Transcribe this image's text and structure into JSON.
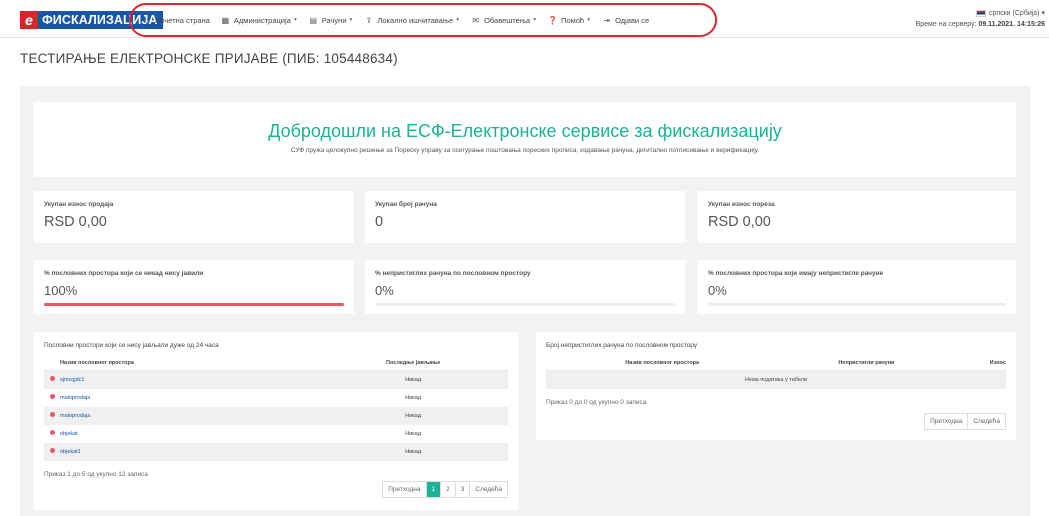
{
  "brand": {
    "letter": "е",
    "name": "ФИСКАЛИЗАЦИЈА",
    "icon": "fiscal-logo-icon"
  },
  "nav": [
    {
      "label": "Почетна страна",
      "icon": "home-icon",
      "glyph": "⌂",
      "caret": false
    },
    {
      "label": "Администрација",
      "icon": "grid-icon",
      "glyph": "▦",
      "caret": true
    },
    {
      "label": "Рачуни",
      "icon": "list-icon",
      "glyph": "▤",
      "caret": true
    },
    {
      "label": "Локално ишчитавање",
      "icon": "upload-icon",
      "glyph": "⇪",
      "caret": true
    },
    {
      "label": "Обавештења",
      "icon": "envelope-icon",
      "glyph": "✉",
      "caret": true
    },
    {
      "label": "Помоћ",
      "icon": "question-icon",
      "glyph": "❓",
      "caret": true
    },
    {
      "label": "Одјави се",
      "icon": "logout-icon",
      "glyph": "⇥",
      "caret": false
    }
  ],
  "language": "српски (Србија)",
  "server_time_label": "Време на серверу:",
  "server_time": "09.11.2021. 14:15:26",
  "page_title": "ТЕСТИРАЊЕ ЕЛЕКТРОНСКЕ ПРИЈАВЕ (ПИБ: 105448634)",
  "welcome": {
    "title": "Добродошли на ЕСФ-Електронске сервисе за фискализацију",
    "subtitle": "СУФ пружа целокупно решење за Пореску управу за осигурање поштовања пореских прописа, издавање рачуна, дигитално потписивање и верификацију."
  },
  "stats": [
    {
      "label": "Укупан износ продаја",
      "value": "RSD 0,00"
    },
    {
      "label": "Укупан број рачуна",
      "value": "0"
    },
    {
      "label": "Укупан износ пореза",
      "value": "RSD 0,00"
    }
  ],
  "percentages": [
    {
      "label": "% пословних простора који се никад нису јавили",
      "value": "100%",
      "fill": 1.0
    },
    {
      "label": "% непристиглих рачуна по пословном простору",
      "value": "0%",
      "fill": 0.0
    },
    {
      "label": "% пословних простора који имају непристигле рачуне",
      "value": "0%",
      "fill": 0.0
    }
  ],
  "table_left": {
    "title": "Пословни простори који се нису јављали дуже од 24 часа",
    "headers": [
      "",
      "Назив пословног простора",
      "Последње јављање"
    ],
    "rows": [
      [
        "sjmcqjdc1",
        "Никад"
      ],
      [
        "maloprodaja",
        "Никад"
      ],
      [
        "maloprodaja",
        "Никад"
      ],
      [
        "objekat",
        "Никад"
      ],
      [
        "objekat1",
        "Никад"
      ]
    ],
    "info": "Приказ 1 до 5 од укупно 12 записа",
    "pager": [
      "Претходна",
      "1",
      "2",
      "3",
      "Следећа"
    ]
  },
  "table_right": {
    "title": "Број непристиглих рачуна по пословном простору",
    "headers": [
      "Назив пословног простора",
      "Непристигли рачуни",
      "Износ"
    ],
    "empty": "Нема података у табели",
    "info": "Приказ 0 до 0 од укупно 0 записа",
    "pager": [
      "Претходна",
      "Следећа"
    ]
  },
  "colors": {
    "accent": "#1ab394",
    "danger": "#ed5565",
    "brand": "#1a56a8",
    "brand_red": "#d6262c"
  }
}
